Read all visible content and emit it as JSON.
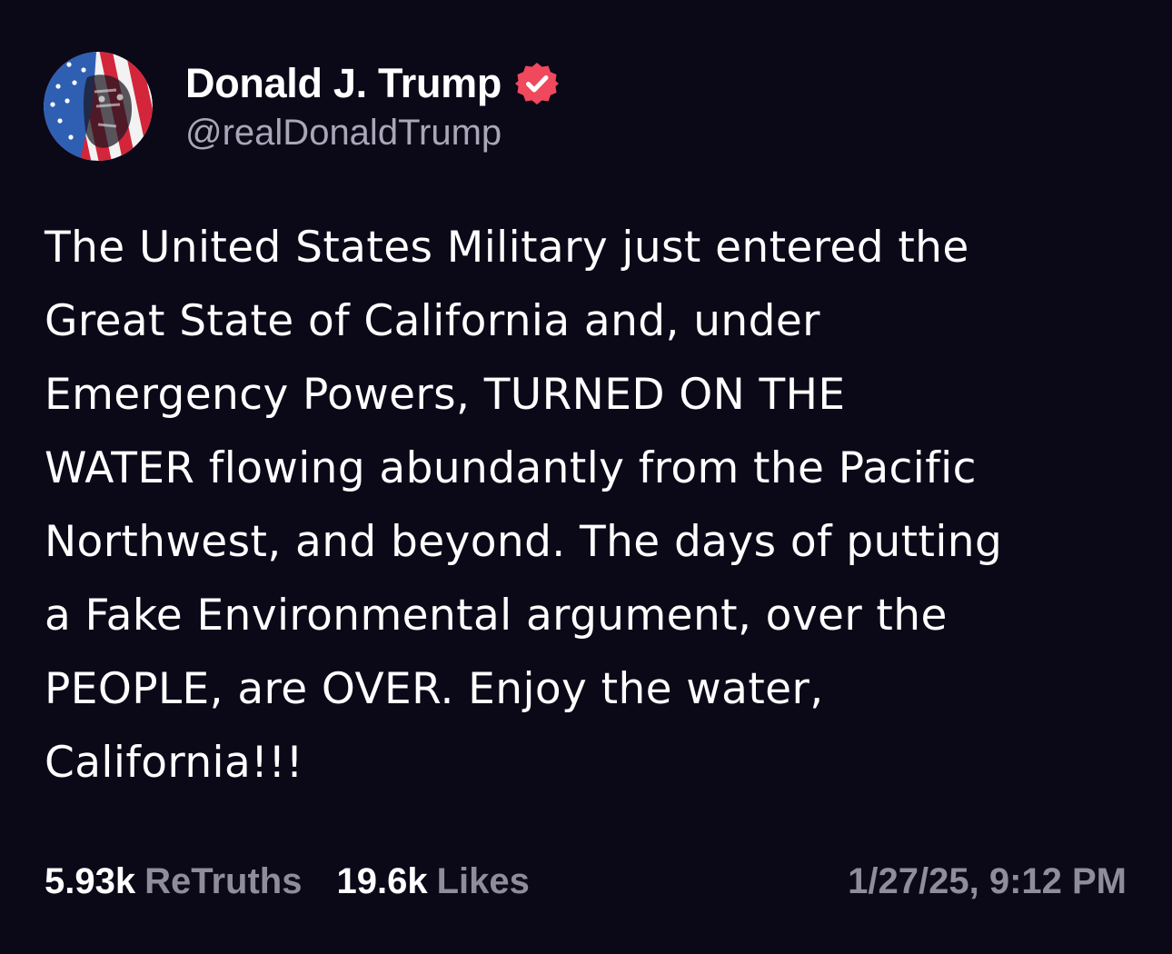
{
  "post": {
    "author": {
      "display_name": "Donald J. Trump",
      "handle": "@realDonaldTrump",
      "verified": true,
      "avatar_icon": "stars-and-stripes-portrait-avatar"
    },
    "text": "The United States Military just entered the\nGreat State of California and, under\nEmergency Powers, TURNED ON THE\nWATER flowing abundantly from the Pacific\nNorthwest, and beyond. The days of putting\na Fake Environmental argument, over the\nPEOPLE, are OVER. Enjoy the water,\nCalifornia!!!",
    "stats": {
      "retruths_count": "5.93k",
      "retruths_label": "ReTruths",
      "likes_count": "19.6k",
      "likes_label": "Likes"
    },
    "timestamp": "1/27/25, 9:12 PM"
  },
  "colors": {
    "background": "#0b0818",
    "primary_text": "#ffffff",
    "secondary_text": "#8f8c9c",
    "verified_badge": "#f0485c"
  }
}
